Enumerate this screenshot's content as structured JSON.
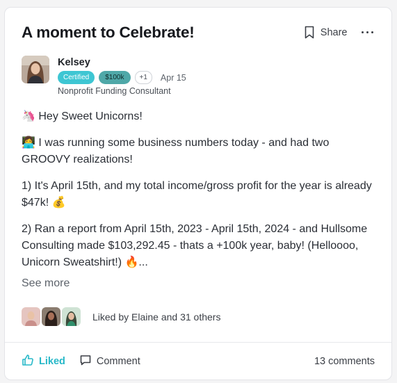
{
  "post": {
    "title": "A moment to Celebrate!",
    "share_label": "Share",
    "author": {
      "name": "Kelsey",
      "badges": [
        "Certified",
        "$100k"
      ],
      "extra_badges": "+1",
      "date": "Apr 15",
      "role": "Nonprofit Funding Consultant"
    },
    "paragraphs": [
      {
        "emoji": "🦄",
        "text": "Hey Sweet Unicorns!"
      },
      {
        "emoji": "👩‍💻",
        "text": "I was running some business numbers today - and had two GROOVY realizations!"
      },
      {
        "text": "1) It's April 15th, and my total income/gross profit for the year is already $47k!",
        "emoji_after": "💰"
      },
      {
        "text": "2) Ran a report from April 15th, 2023 - April 15th, 2024 - and Hullsome Consulting made $103,292.45 - thats a +100k year, baby! (Helloooo, Unicorn Sweatshirt!)",
        "emoji_after": "🔥",
        "suffix": "..."
      }
    ],
    "see_more": "See more",
    "likes_text": "Liked by Elaine and 31 others",
    "liked_label": "Liked",
    "comment_label": "Comment",
    "comments_count": "13 comments"
  },
  "colors": {
    "accent": "#26b8c8",
    "certified_badge": "#3ec6d3",
    "level_badge": "#4fa8a8"
  },
  "icons": [
    "bookmark-icon",
    "more-horizontal-icon",
    "thumbs-up-icon",
    "comment-icon"
  ]
}
